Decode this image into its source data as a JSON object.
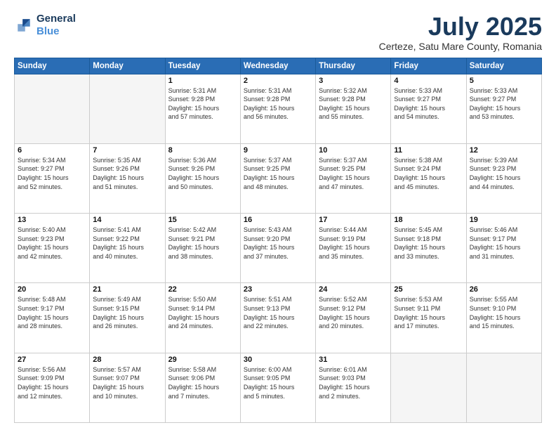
{
  "header": {
    "logo_line1": "General",
    "logo_line2": "Blue",
    "month": "July 2025",
    "location": "Certeze, Satu Mare County, Romania"
  },
  "weekdays": [
    "Sunday",
    "Monday",
    "Tuesday",
    "Wednesday",
    "Thursday",
    "Friday",
    "Saturday"
  ],
  "weeks": [
    [
      {
        "day": "",
        "info": ""
      },
      {
        "day": "",
        "info": ""
      },
      {
        "day": "1",
        "info": "Sunrise: 5:31 AM\nSunset: 9:28 PM\nDaylight: 15 hours\nand 57 minutes."
      },
      {
        "day": "2",
        "info": "Sunrise: 5:31 AM\nSunset: 9:28 PM\nDaylight: 15 hours\nand 56 minutes."
      },
      {
        "day": "3",
        "info": "Sunrise: 5:32 AM\nSunset: 9:28 PM\nDaylight: 15 hours\nand 55 minutes."
      },
      {
        "day": "4",
        "info": "Sunrise: 5:33 AM\nSunset: 9:27 PM\nDaylight: 15 hours\nand 54 minutes."
      },
      {
        "day": "5",
        "info": "Sunrise: 5:33 AM\nSunset: 9:27 PM\nDaylight: 15 hours\nand 53 minutes."
      }
    ],
    [
      {
        "day": "6",
        "info": "Sunrise: 5:34 AM\nSunset: 9:27 PM\nDaylight: 15 hours\nand 52 minutes."
      },
      {
        "day": "7",
        "info": "Sunrise: 5:35 AM\nSunset: 9:26 PM\nDaylight: 15 hours\nand 51 minutes."
      },
      {
        "day": "8",
        "info": "Sunrise: 5:36 AM\nSunset: 9:26 PM\nDaylight: 15 hours\nand 50 minutes."
      },
      {
        "day": "9",
        "info": "Sunrise: 5:37 AM\nSunset: 9:25 PM\nDaylight: 15 hours\nand 48 minutes."
      },
      {
        "day": "10",
        "info": "Sunrise: 5:37 AM\nSunset: 9:25 PM\nDaylight: 15 hours\nand 47 minutes."
      },
      {
        "day": "11",
        "info": "Sunrise: 5:38 AM\nSunset: 9:24 PM\nDaylight: 15 hours\nand 45 minutes."
      },
      {
        "day": "12",
        "info": "Sunrise: 5:39 AM\nSunset: 9:23 PM\nDaylight: 15 hours\nand 44 minutes."
      }
    ],
    [
      {
        "day": "13",
        "info": "Sunrise: 5:40 AM\nSunset: 9:23 PM\nDaylight: 15 hours\nand 42 minutes."
      },
      {
        "day": "14",
        "info": "Sunrise: 5:41 AM\nSunset: 9:22 PM\nDaylight: 15 hours\nand 40 minutes."
      },
      {
        "day": "15",
        "info": "Sunrise: 5:42 AM\nSunset: 9:21 PM\nDaylight: 15 hours\nand 38 minutes."
      },
      {
        "day": "16",
        "info": "Sunrise: 5:43 AM\nSunset: 9:20 PM\nDaylight: 15 hours\nand 37 minutes."
      },
      {
        "day": "17",
        "info": "Sunrise: 5:44 AM\nSunset: 9:19 PM\nDaylight: 15 hours\nand 35 minutes."
      },
      {
        "day": "18",
        "info": "Sunrise: 5:45 AM\nSunset: 9:18 PM\nDaylight: 15 hours\nand 33 minutes."
      },
      {
        "day": "19",
        "info": "Sunrise: 5:46 AM\nSunset: 9:17 PM\nDaylight: 15 hours\nand 31 minutes."
      }
    ],
    [
      {
        "day": "20",
        "info": "Sunrise: 5:48 AM\nSunset: 9:17 PM\nDaylight: 15 hours\nand 28 minutes."
      },
      {
        "day": "21",
        "info": "Sunrise: 5:49 AM\nSunset: 9:15 PM\nDaylight: 15 hours\nand 26 minutes."
      },
      {
        "day": "22",
        "info": "Sunrise: 5:50 AM\nSunset: 9:14 PM\nDaylight: 15 hours\nand 24 minutes."
      },
      {
        "day": "23",
        "info": "Sunrise: 5:51 AM\nSunset: 9:13 PM\nDaylight: 15 hours\nand 22 minutes."
      },
      {
        "day": "24",
        "info": "Sunrise: 5:52 AM\nSunset: 9:12 PM\nDaylight: 15 hours\nand 20 minutes."
      },
      {
        "day": "25",
        "info": "Sunrise: 5:53 AM\nSunset: 9:11 PM\nDaylight: 15 hours\nand 17 minutes."
      },
      {
        "day": "26",
        "info": "Sunrise: 5:55 AM\nSunset: 9:10 PM\nDaylight: 15 hours\nand 15 minutes."
      }
    ],
    [
      {
        "day": "27",
        "info": "Sunrise: 5:56 AM\nSunset: 9:09 PM\nDaylight: 15 hours\nand 12 minutes."
      },
      {
        "day": "28",
        "info": "Sunrise: 5:57 AM\nSunset: 9:07 PM\nDaylight: 15 hours\nand 10 minutes."
      },
      {
        "day": "29",
        "info": "Sunrise: 5:58 AM\nSunset: 9:06 PM\nDaylight: 15 hours\nand 7 minutes."
      },
      {
        "day": "30",
        "info": "Sunrise: 6:00 AM\nSunset: 9:05 PM\nDaylight: 15 hours\nand 5 minutes."
      },
      {
        "day": "31",
        "info": "Sunrise: 6:01 AM\nSunset: 9:03 PM\nDaylight: 15 hours\nand 2 minutes."
      },
      {
        "day": "",
        "info": ""
      },
      {
        "day": "",
        "info": ""
      }
    ]
  ]
}
